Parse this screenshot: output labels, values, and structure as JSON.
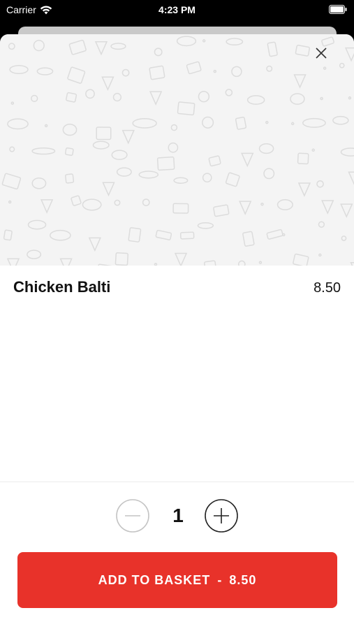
{
  "status_bar": {
    "carrier": "Carrier",
    "time": "4:23 PM"
  },
  "item": {
    "name": "Chicken Balti",
    "price": "8.50"
  },
  "quantity": {
    "value": "1"
  },
  "add_button": {
    "label": "ADD TO BASKET",
    "separator": "-",
    "price": "8.50"
  },
  "colors": {
    "accent": "#e8322a",
    "hero_bg": "#f4f4f4",
    "doodle": "#dcdcdc"
  },
  "icons": {
    "close": "close-icon",
    "minus": "minus-circle-icon",
    "plus": "plus-circle-icon",
    "wifi": "wifi-icon",
    "battery": "battery-icon"
  }
}
